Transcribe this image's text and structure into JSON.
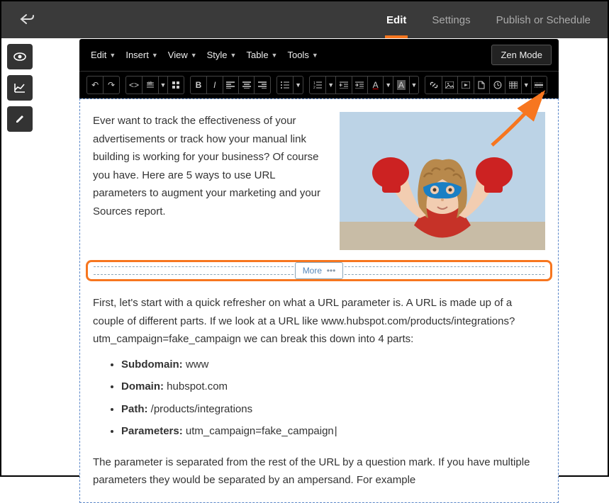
{
  "topnav": {
    "tabs": [
      {
        "label": "Edit",
        "active": true
      },
      {
        "label": "Settings",
        "active": false
      },
      {
        "label": "Publish or Schedule",
        "active": false
      }
    ]
  },
  "toolbar": {
    "menus": [
      "Edit",
      "Insert",
      "View",
      "Style",
      "Table",
      "Tools"
    ],
    "zen_label": "Zen Mode"
  },
  "side_tools": [
    "preview-icon",
    "analytics-icon",
    "edit-icon"
  ],
  "content": {
    "intro": "Ever want to track the effectiveness of your advertisements or track how your manual link building is working for your business?  Of course you have.  Here are 5 ways to use URL parameters to augment your marketing and your Sources report.",
    "more_label": "More",
    "refresher": "First, let's start with a quick refresher on what a URL parameter is. A URL is made up of a couple of different parts. If we look at a URL like www.hubspot.com/products/integrations?utm_campaign=fake_campaign we can break this down into 4 parts:",
    "bullets": [
      {
        "term": "Subdomain:",
        "value": "www"
      },
      {
        "term": "Domain:",
        "value": "hubspot.com"
      },
      {
        "term": "Path:",
        "value": "/products/integrations"
      },
      {
        "term": "Parameters:",
        "value": "utm_campaign=fake_campaign"
      }
    ],
    "outro": "The parameter is separated from the rest of the URL by a question mark. If you have multiple parameters they would be separated by an ampersand. For example"
  }
}
